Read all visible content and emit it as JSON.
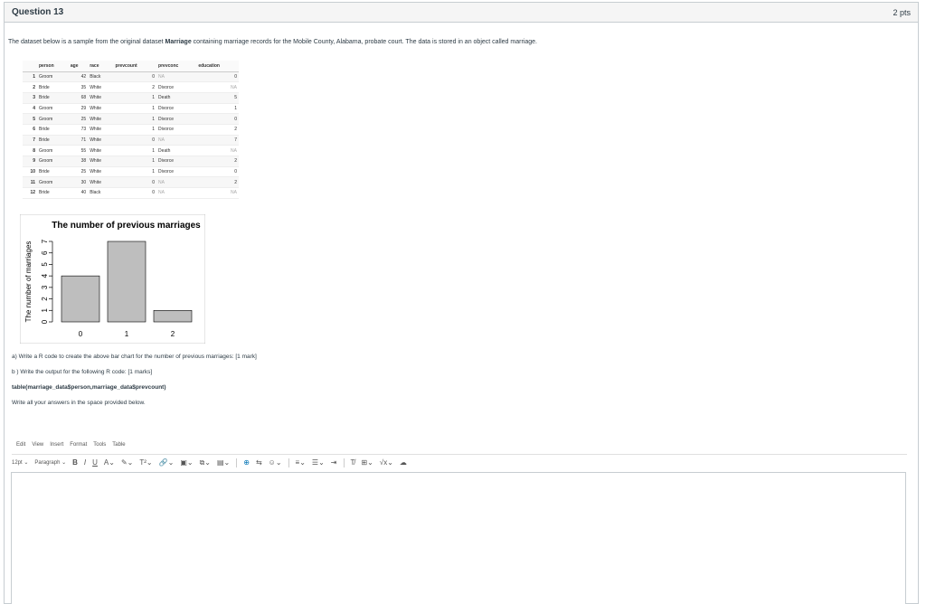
{
  "question": {
    "title": "Question 13",
    "points": "2 pts",
    "intro_before": "The dataset below is a sample from the original dataset ",
    "intro_bold": "Marriage",
    "intro_after": " containing marriage records for the Mobile County, Alabama, probate court. The data is stored in an object called marriage."
  },
  "table": {
    "headers": [
      "",
      "person",
      "age",
      "race",
      "prevcount",
      "prevconc",
      "education"
    ],
    "rows": [
      [
        "1",
        "Groom",
        "42",
        "Black",
        "0",
        "NA",
        "0"
      ],
      [
        "2",
        "Bride",
        "35",
        "White",
        "2",
        "Divorce",
        "NA"
      ],
      [
        "3",
        "Bride",
        "68",
        "White",
        "1",
        "Death",
        "5"
      ],
      [
        "4",
        "Groom",
        "29",
        "White",
        "1",
        "Divorce",
        "1"
      ],
      [
        "5",
        "Groom",
        "25",
        "White",
        "1",
        "Divorce",
        "0"
      ],
      [
        "6",
        "Bride",
        "73",
        "White",
        "1",
        "Divorce",
        "2"
      ],
      [
        "7",
        "Bride",
        "71",
        "White",
        "0",
        "NA",
        "7"
      ],
      [
        "8",
        "Groom",
        "55",
        "White",
        "1",
        "Death",
        "NA"
      ],
      [
        "9",
        "Groom",
        "38",
        "White",
        "1",
        "Divorce",
        "2"
      ],
      [
        "10",
        "Bride",
        "25",
        "White",
        "1",
        "Divorce",
        "0"
      ],
      [
        "11",
        "Groom",
        "30",
        "White",
        "0",
        "NA",
        "2"
      ],
      [
        "12",
        "Bride",
        "40",
        "Black",
        "0",
        "NA",
        "NA"
      ]
    ]
  },
  "chart_data": {
    "type": "bar",
    "title": "The number of previous marriages",
    "categories": [
      "0",
      "1",
      "2"
    ],
    "values": [
      4,
      7,
      1
    ],
    "xlabel": "",
    "ylabel": "The number of marriages",
    "ylim": [
      0,
      7
    ],
    "yticks": [
      "0",
      "1",
      "2",
      "3",
      "4",
      "5",
      "6",
      "7"
    ],
    "bar_color": "#bebebe",
    "grid": false
  },
  "prompts": {
    "a": "a) Write a R code to create the above bar chart for the number of previous marriages: [1 mark]",
    "b": "b ) Write the output for the following R code: [1 marks]",
    "code": "table(marriage_data$person,marriage_data$prevcount)",
    "instruction": "Write all your answers in the space provided below."
  },
  "editor": {
    "menu": [
      "Edit",
      "View",
      "Insert",
      "Format",
      "Tools",
      "Table"
    ],
    "font_size": "12pt",
    "block_format": "Paragraph"
  }
}
